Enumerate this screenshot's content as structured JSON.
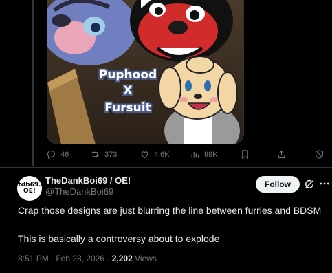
{
  "media": {
    "overlay_lines": [
      "Puphood",
      "X",
      "Fursuit"
    ]
  },
  "actions": {
    "replies": "46",
    "reposts": "373",
    "likes": "4.6K",
    "views": "99K"
  },
  "reply": {
    "avatar_text_line1": "tdb69.",
    "avatar_text_line2": "OE!",
    "display_name": "TheDankBoi69 / OE!",
    "handle": "@TheDankBoi69",
    "follow_label": "Follow",
    "body_line1": "Crap those designs are just blurring the line between furries and BDSM",
    "body_line2": "This is basically a controversy about to explode",
    "timestamp": "8:51 PM · Feb 28, 2026 · ",
    "view_count": "2,202",
    "views_label": " Views"
  },
  "colors": {
    "background": "#000000",
    "text_primary": "#e7e9ea",
    "text_secondary": "#71767b",
    "divider": "#2f3336",
    "follow_bg": "#eff3f4"
  }
}
